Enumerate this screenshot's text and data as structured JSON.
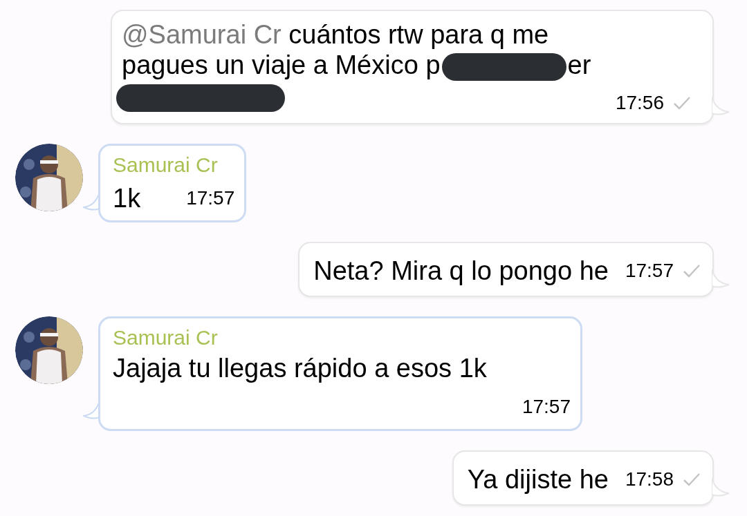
{
  "messages": [
    {
      "kind": "outgoing",
      "parts": [
        {
          "kind": "mention",
          "text": "@Samurai Cr"
        },
        {
          "kind": "text",
          "text": " cuántos rtw para q me pagues un viaje a México p"
        },
        {
          "kind": "redaction"
        },
        {
          "kind": "text",
          "text": "er "
        },
        {
          "kind": "redaction"
        }
      ],
      "time": "17:56",
      "delivered": true
    },
    {
      "kind": "incoming",
      "sender": "Samurai Cr",
      "parts": [
        {
          "kind": "text",
          "text": "1k"
        }
      ],
      "time": "17:57"
    },
    {
      "kind": "outgoing",
      "parts": [
        {
          "kind": "text",
          "text": "Neta? Mira q lo pongo he"
        }
      ],
      "time": "17:57",
      "delivered": true
    },
    {
      "kind": "incoming",
      "sender": "Samurai Cr",
      "parts": [
        {
          "kind": "text",
          "text": "Jajaja tu llegas rápido a esos 1k"
        }
      ],
      "time": "17:57"
    },
    {
      "kind": "outgoing",
      "parts": [
        {
          "kind": "text",
          "text": "Ya dijiste he"
        }
      ],
      "time": "17:58",
      "delivered": true
    }
  ]
}
